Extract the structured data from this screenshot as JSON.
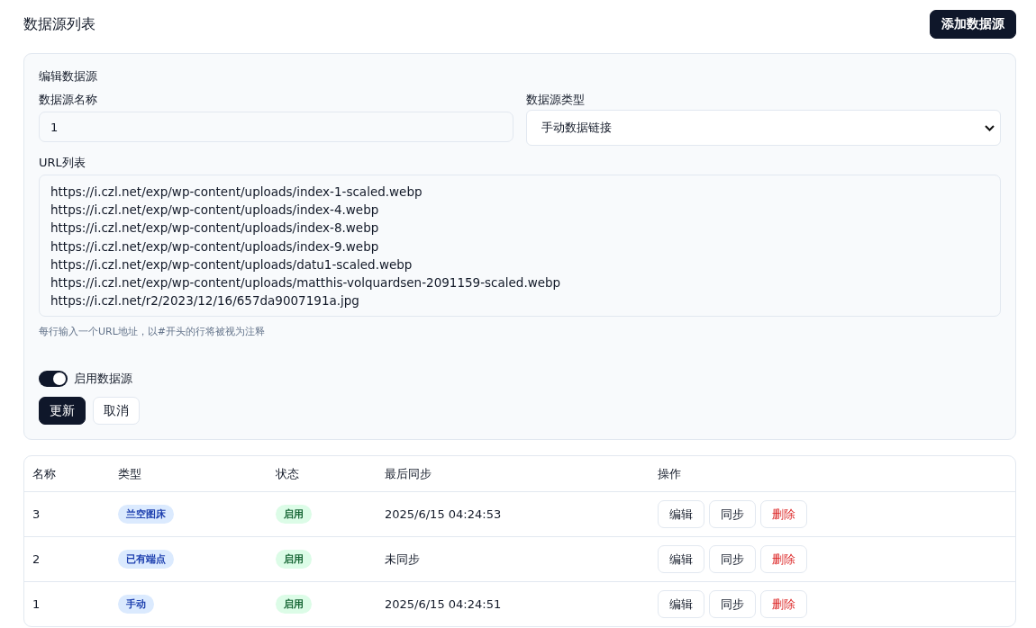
{
  "page_title": "数据源列表",
  "add_button": "添加数据源",
  "edit_form": {
    "title": "编辑数据源",
    "name_field": {
      "label": "数据源名称",
      "value": "1"
    },
    "type_field": {
      "label": "数据源类型",
      "value": "手动数据链接"
    },
    "url_field": {
      "label": "URL列表",
      "lines": [
        "https://i.czl.net/exp/wp-content/uploads/index-1-scaled.webp",
        "https://i.czl.net/exp/wp-content/uploads/index-4.webp",
        "https://i.czl.net/exp/wp-content/uploads/index-8.webp",
        "https://i.czl.net/exp/wp-content/uploads/index-9.webp",
        "https://i.czl.net/exp/wp-content/uploads/datu1-scaled.webp",
        "https://i.czl.net/exp/wp-content/uploads/matthis-volquardsen-2091159-scaled.webp",
        "https://i.czl.net/r2/2023/12/16/657da9007191a.jpg"
      ],
      "hint": "每行输入一个URL地址，以#开头的行将被视为注释"
    },
    "enable_toggle": {
      "label": "启用数据源",
      "on": true
    },
    "submit_button": "更新",
    "cancel_button": "取消"
  },
  "table": {
    "columns": [
      "名称",
      "类型",
      "状态",
      "最后同步",
      "操作"
    ],
    "rows": [
      {
        "name": "3",
        "type": "兰空图床",
        "status": "启用",
        "enabled": true,
        "last_sync": "2025/6/15 04:24:53",
        "actions": [
          "编辑",
          "同步",
          "删除"
        ]
      },
      {
        "name": "2",
        "type": "已有端点",
        "status": "启用",
        "enabled": true,
        "last_sync": "未同步",
        "actions": [
          "编辑",
          "同步",
          "删除"
        ]
      },
      {
        "name": "1",
        "type": "手动",
        "status": "启用",
        "enabled": true,
        "last_sync": "2025/6/15 04:24:51",
        "actions": [
          "编辑",
          "同步",
          "删除"
        ]
      }
    ]
  }
}
